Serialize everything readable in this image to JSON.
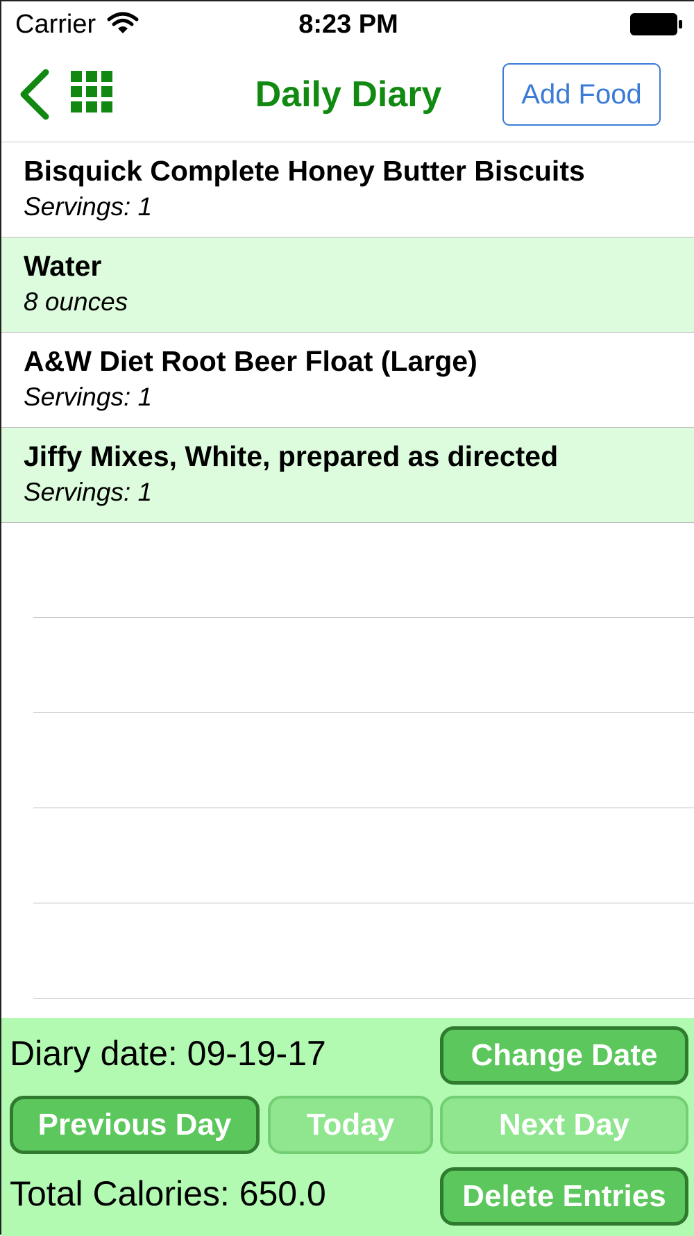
{
  "status_bar": {
    "carrier": "Carrier",
    "time": "8:23 PM",
    "wifi_icon": "wifi-icon",
    "battery_icon": "battery-full-icon"
  },
  "nav": {
    "back_icon": "chevron-left-icon",
    "grid_icon": "grid-icon",
    "title": "Daily Diary",
    "add_food": "Add Food",
    "accent_color": "#128a12",
    "button_color": "#3a7bd5"
  },
  "entries": [
    {
      "name": "Bisquick Complete Honey Butter Biscuits",
      "detail": "Servings: 1"
    },
    {
      "name": "Water",
      "detail": "8 ounces"
    },
    {
      "name": "A&W Diet Root Beer Float (Large)",
      "detail": "Servings: 1"
    },
    {
      "name": "Jiffy Mixes, White, prepared as directed",
      "detail": "Servings: 1"
    }
  ],
  "footer": {
    "diary_date": "Diary date: 09-19-17",
    "total_calories": "Total Calories: 650.0",
    "change_date": "Change Date",
    "previous_day": "Previous Day",
    "today": "Today",
    "next_day": "Next Day",
    "delete_entries": "Delete Entries",
    "panel_color": "#b2fab2"
  }
}
